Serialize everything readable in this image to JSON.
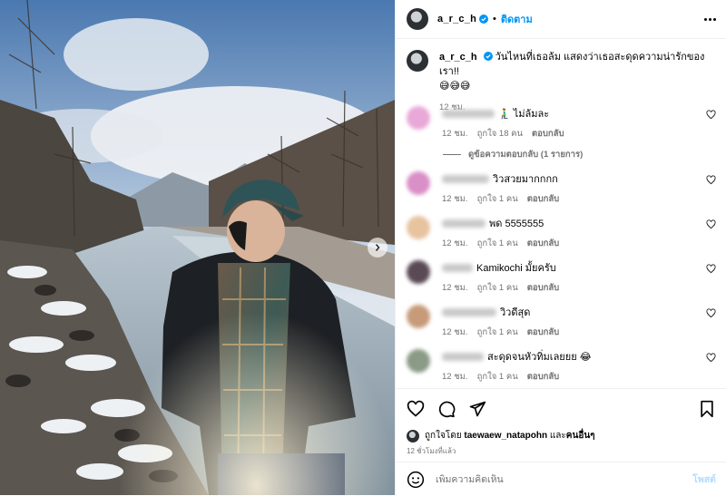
{
  "post": {
    "username": "a_r_c_h",
    "dot": "•",
    "follow_label": "ติดตาม",
    "caption_text": "วันไหนที่เธอล้ม แสดงว่าเธอสะดุดความน่ารักของเรา!!",
    "caption_emoji": "😅😅😅",
    "caption_time": "12 ชม."
  },
  "comments": [
    {
      "text": "🧎‍♂️ ไม่ล้มละ",
      "time": "12 ชม.",
      "likes": "ถูกใจ 18 คน",
      "reply": "ตอบกลับ"
    },
    {
      "text": "วิวสวยมากกกก",
      "time": "12 ชม.",
      "likes": "ถูกใจ 1 คน",
      "reply": "ตอบกลับ"
    },
    {
      "text": "พด 5555555",
      "time": "12 ชม.",
      "likes": "ถูกใจ 1 คน",
      "reply": "ตอบกลับ"
    },
    {
      "text": "Kamikochi มั้ยครับ",
      "time": "12 ชม.",
      "likes": "ถูกใจ 1 คน",
      "reply": "ตอบกลับ"
    },
    {
      "text": "วิวดีสุด",
      "time": "12 ชม.",
      "likes": "ถูกใจ 1 คน",
      "reply": "ตอบกลับ"
    },
    {
      "text": "สะดุดจนหัวทิ่มเลยยย 😂",
      "time": "12 ชม.",
      "likes": "ถูกใจ 1 คน",
      "reply": "ตอบกลับ"
    }
  ],
  "view_replies": "ดูข้อความตอบกลับ (1 รายการ)",
  "likes_line": {
    "prefix": "ถูกใจโดย",
    "user": "taewaew_natapohn",
    "and": "และ",
    "others": "คนอื่นๆ"
  },
  "time_ago": "12 ชั่วโมงที่แล้ว",
  "add_comment": {
    "placeholder": "เพิ่มความคิดเห็น",
    "post_label": "โพสต์"
  },
  "colors": {
    "accent": "#0095f6",
    "muted": "#737373",
    "post_disabled": "#b3dbff",
    "divider": "#efefef"
  },
  "icons": [
    "more-options-icon",
    "verified-badge-icon",
    "heart-icon",
    "comment-icon",
    "share-icon",
    "bookmark-icon",
    "emoji-icon",
    "chevron-right-icon"
  ]
}
